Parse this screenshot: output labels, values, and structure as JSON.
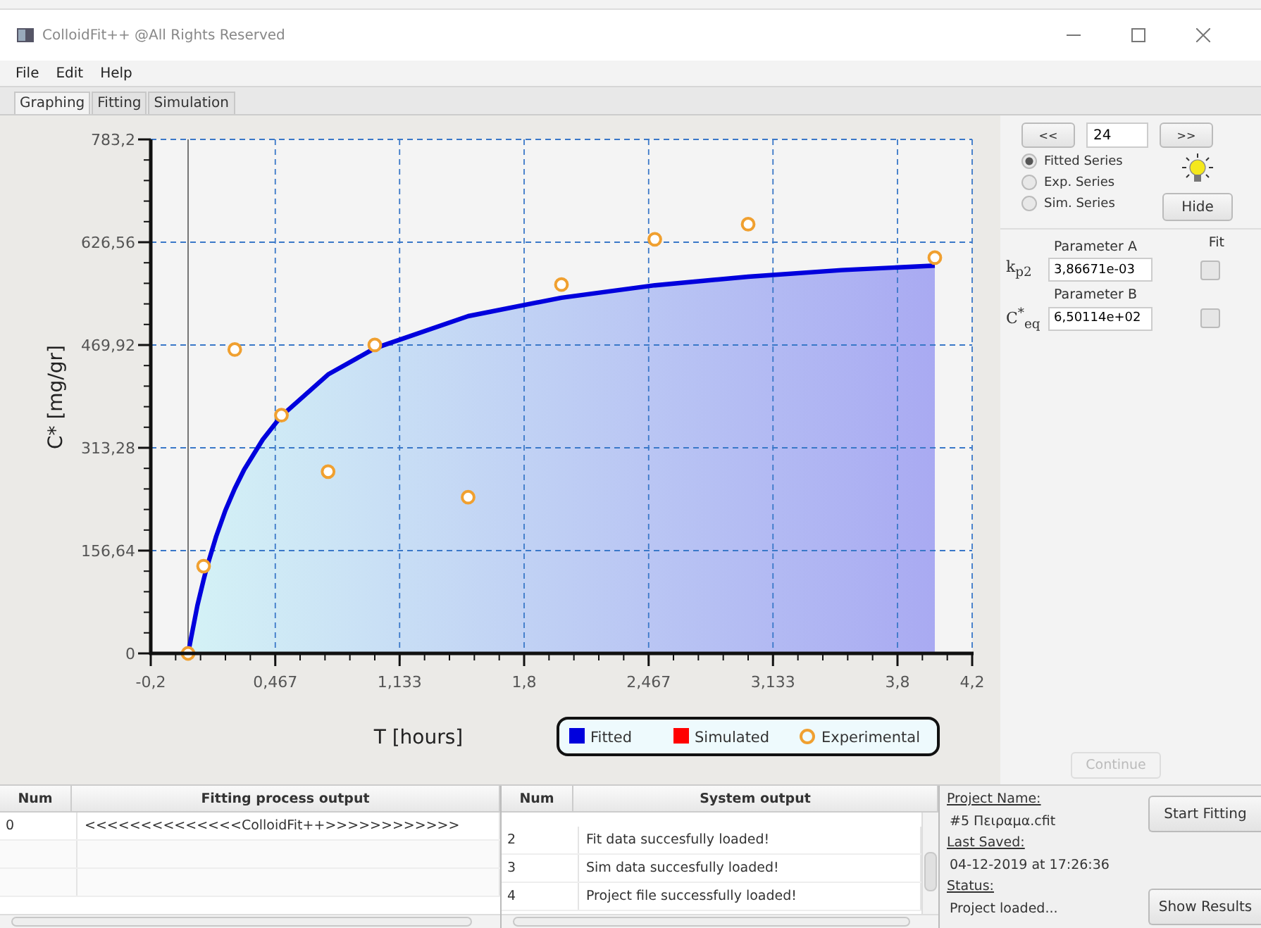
{
  "window": {
    "title": "ColloidFit++ @All Rights Reserved"
  },
  "menu": [
    "File",
    "Edit",
    "Help"
  ],
  "tabs": [
    {
      "label": "Graphing",
      "selected": true
    },
    {
      "label": "Fitting",
      "selected": false
    },
    {
      "label": "Simulation",
      "selected": false
    }
  ],
  "chart": {
    "chart_data": {
      "type": "area",
      "grid": true,
      "legend": "bottom",
      "xlabel": "T [hours]",
      "ylabel": "C* [mg/gr]",
      "x": [
        0,
        0.05,
        0.083,
        0.1,
        0.15,
        0.2,
        0.25,
        0.3,
        0.4,
        0.5,
        0.75,
        1,
        1.5,
        2,
        2.5,
        3,
        3.5,
        4
      ],
      "series": [
        {
          "name": "Fitted",
          "color": "#0000dd",
          "values": [
            0,
            73,
            112,
            131,
            178,
            218,
            251,
            280,
            326,
            362,
            425,
            465,
            514,
            542,
            561,
            574,
            584,
            591
          ]
        },
        {
          "name": "Simulated",
          "color": "#ff0000",
          "values": [
            null,
            null,
            null,
            null,
            null,
            null,
            null,
            null,
            null,
            null,
            null,
            null,
            null,
            null,
            null,
            null,
            null,
            null
          ]
        },
        {
          "name": "Experimental",
          "color": "#f0a030",
          "type": "scatter",
          "values": [
            0,
            null,
            133,
            null,
            null,
            null,
            463,
            null,
            null,
            363,
            277,
            470,
            238,
            562,
            631,
            654,
            null,
            603
          ]
        }
      ],
      "xlim": [
        -0.2,
        4.2
      ],
      "ylim": [
        0,
        783.2
      ],
      "xticks": [
        {
          "value": -0.2,
          "label": "-0,2"
        },
        {
          "value": 0.467,
          "label": "0,467"
        },
        {
          "value": 1.133,
          "label": "1,133"
        },
        {
          "value": 1.8,
          "label": "1,8"
        },
        {
          "value": 2.467,
          "label": "2,467"
        },
        {
          "value": 3.133,
          "label": "3,133"
        },
        {
          "value": 3.8,
          "label": "3,8"
        },
        {
          "value": 4.2,
          "label": "4,2"
        }
      ],
      "yticks": [
        {
          "value": 0,
          "label": "0"
        },
        {
          "value": 156.64,
          "label": "156,64"
        },
        {
          "value": 313.28,
          "label": "313,28"
        },
        {
          "value": 469.92,
          "label": "469,92"
        },
        {
          "value": 626.56,
          "label": "626,56"
        },
        {
          "value": 783.2,
          "label": "783,2"
        }
      ]
    }
  },
  "controls": {
    "prev": "<<",
    "index": "24",
    "next": ">>",
    "hide": "Hide",
    "continue": {
      "label": "Continue",
      "disabled": true
    },
    "series_options": [
      {
        "label": "Fitted Series",
        "selected": true
      },
      {
        "label": "Exp. Series",
        "selected": false
      },
      {
        "label": "Sim. Series",
        "selected": false
      }
    ],
    "fit_header": "Fit",
    "parameters": [
      {
        "caption": "Parameter A",
        "symbol": "k$_{p2}$",
        "value": "3,86671e-03",
        "fit": false
      },
      {
        "caption": "Parameter B",
        "symbol": "C$^{*}$$_{eq}$",
        "value": "6,50114e+02",
        "fit": false
      }
    ]
  },
  "fitting_table": {
    "columns": [
      "Num",
      "Fitting process output"
    ],
    "rows": [
      {
        "num": "0",
        "text": "<<<<<<<<<<<<<<ColloidFit++>>>>>>>>>>>>"
      }
    ]
  },
  "system_table": {
    "columns": [
      "Num",
      "System output"
    ],
    "rows": [
      {
        "num": "2",
        "text": "Fit data succesfully loaded!"
      },
      {
        "num": "3",
        "text": "Sim data succesfully loaded!"
      },
      {
        "num": "4",
        "text": "Project file successfully loaded!"
      }
    ]
  },
  "project": {
    "name_label": "Project Name:",
    "name": "#5 Πειραμα.cfit",
    "saved_label": "Last Saved:",
    "saved": "04-12-2019 at 17:26:36",
    "status_label": "Status:",
    "status": "Project loaded..."
  },
  "buttons": {
    "start": "Start Fitting",
    "results": "Show Results"
  }
}
